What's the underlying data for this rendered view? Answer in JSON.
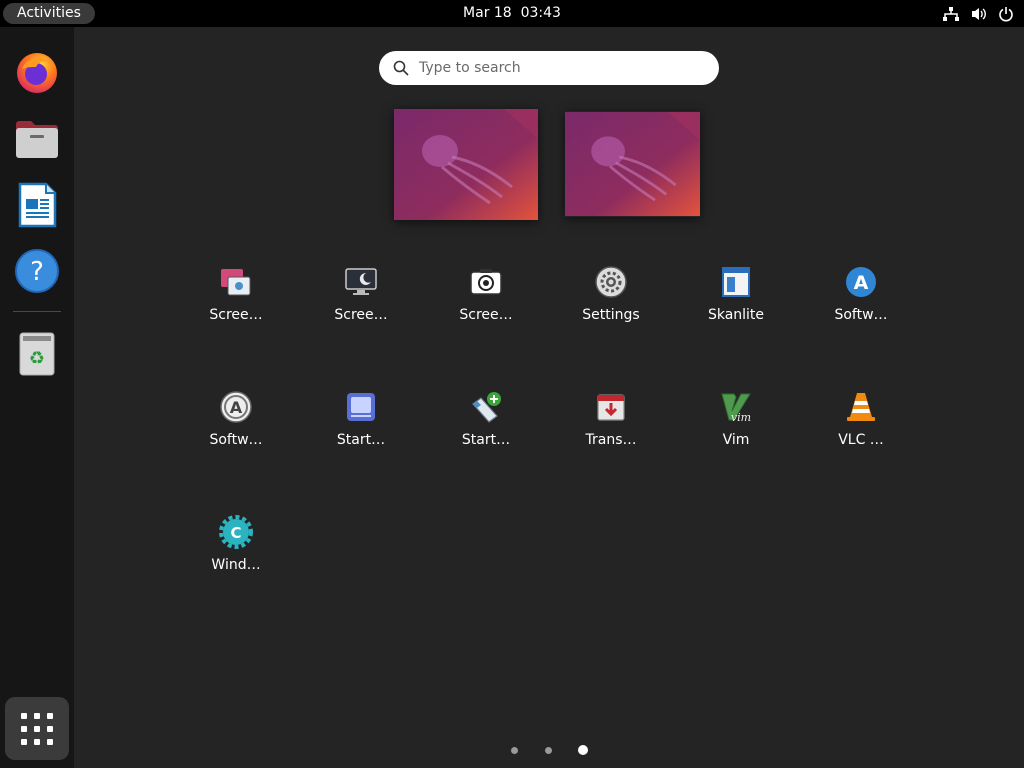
{
  "topbar": {
    "activities_label": "Activities",
    "clock": "Mar 18  03:43",
    "tray_icons": [
      "network-icon",
      "volume-icon",
      "power-icon"
    ]
  },
  "dock": {
    "items": [
      {
        "name": "firefox",
        "icon": "firefox-icon"
      },
      {
        "name": "files",
        "icon": "files-icon"
      },
      {
        "name": "libreoffice-writer",
        "icon": "writer-icon"
      },
      {
        "name": "help",
        "icon": "help-icon"
      },
      {
        "name": "trash",
        "icon": "trash-icon"
      }
    ],
    "show_apps_icon": "apps-grid-icon"
  },
  "search": {
    "placeholder": "Type to search"
  },
  "workspaces": [
    {
      "index": 1,
      "active": true
    },
    {
      "index": 2,
      "active": false
    }
  ],
  "apps": [
    {
      "label": "Scree…",
      "icon": "screenshot-icon"
    },
    {
      "label": "Scree…",
      "icon": "screensaver-icon"
    },
    {
      "label": "Scree…",
      "icon": "screen-camera-icon"
    },
    {
      "label": "Settings",
      "icon": "settings-icon"
    },
    {
      "label": "Skanlite",
      "icon": "skanlite-icon"
    },
    {
      "label": "Softw…",
      "icon": "software-icon"
    },
    {
      "label": "Softw…",
      "icon": "software-updater-icon"
    },
    {
      "label": "Start…",
      "icon": "startup-applications-icon"
    },
    {
      "label": "Start…",
      "icon": "startup-disk-creator-icon"
    },
    {
      "label": "Trans…",
      "icon": "transmission-icon"
    },
    {
      "label": "Vim",
      "icon": "vim-icon"
    },
    {
      "label": "VLC …",
      "icon": "vlc-icon"
    },
    {
      "label": "Wind…",
      "icon": "window-settings-icon"
    }
  ],
  "pager": {
    "pages": 3,
    "current": 3
  },
  "colors": {
    "background": "#242424",
    "dock": "#161616",
    "topbar": "#000000",
    "accent_orange": "#e95420"
  }
}
